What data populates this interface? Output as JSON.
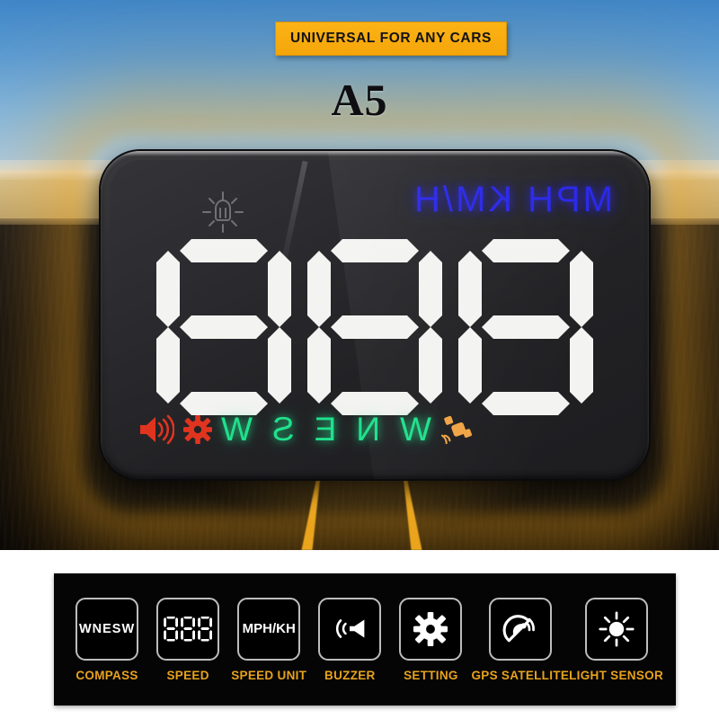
{
  "header": {
    "banner_text": "UNIVERSAL FOR ANY CARS",
    "model_name": "A5",
    "banner_color": "#f8ae12",
    "banner_text_color": "#121212"
  },
  "hud": {
    "light_sensor_icon": "sun-light-sensor-icon",
    "units_display": "MPH KM/H",
    "units_color": "#2a28e8",
    "speed_value": "888",
    "digit_color": "#f3f3f1",
    "digits": [
      {
        "value": "8",
        "segments": [
          "A",
          "B",
          "C",
          "D",
          "E",
          "F",
          "G"
        ]
      },
      {
        "value": "8",
        "segments": [
          "A",
          "B",
          "C",
          "D",
          "E",
          "F",
          "G"
        ]
      },
      {
        "value": "8",
        "segments": [
          "A",
          "B",
          "C",
          "D",
          "E",
          "F",
          "G"
        ]
      }
    ],
    "status_icons": {
      "buzzer": "speaker-icon",
      "buzzer_color": "#e0341f",
      "setting": "gear-icon",
      "setting_color": "#e0341f",
      "gps": "satellite-icon",
      "gps_color": "#f0a545"
    },
    "compass_letters": [
      "W",
      "N",
      "E",
      "S",
      "W"
    ],
    "compass_color": "#20e08c"
  },
  "features": {
    "items": [
      {
        "icon": "compass-letters-icon",
        "box_text": "WNESW",
        "label": "COMPASS"
      },
      {
        "icon": "seven-segment-digits-icon",
        "box_text": "888",
        "label": "SPEED"
      },
      {
        "icon": "speed-unit-icon",
        "box_text": "MPH/KH",
        "label": "SPEED UNIT"
      },
      {
        "icon": "speaker-icon",
        "box_text": "",
        "label": "BUZZER"
      },
      {
        "icon": "gear-icon",
        "box_text": "",
        "label": "SETTING"
      },
      {
        "icon": "satellite-dish-icon",
        "box_text": "",
        "label": "GPS SATELLITE"
      },
      {
        "icon": "sun-icon",
        "box_text": "",
        "label": "LIGHT SENSOR"
      }
    ],
    "label_color": "#e8a21c",
    "panel_color": "#050505"
  },
  "scene": {
    "sky_color": "#5d9dd4",
    "field_color": "#cdb884",
    "road_color": "#0d0d10",
    "lane_line_color": "#eaa81f",
    "glow_color": "#f0a51e"
  }
}
